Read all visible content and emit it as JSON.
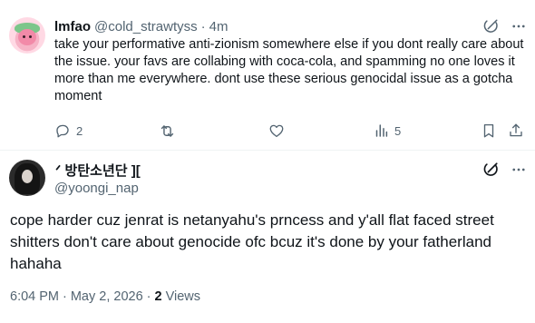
{
  "reply": {
    "display_name": "lmfao",
    "handle": "@cold_strawtyss",
    "separator": "·",
    "time": "4m",
    "text": "take your performative anti-zionism somewhere else if you dont really care about the issue. your favs are collabing with coca-cola,  and spamming no one loves it more than me everywhere. dont use these serious genocidal issue as a gotcha moment",
    "reply_count": "2",
    "retweet_count": "",
    "like_count": "",
    "view_count": "5",
    "icons": [
      "reply-icon",
      "retweet-icon",
      "like-icon",
      "views-icon",
      "bookmark-icon",
      "share-icon",
      "grok-icon",
      "more-icon"
    ]
  },
  "main_tweet": {
    "display_name": "ᐟ 방탄소년단 ][",
    "handle": "@yoongi_nap",
    "text": "cope harder cuz  jenrat is netanyahu's prncess and y'all flat faced street shitters don't care about genocide ofc bcuz it's done by your fatherland hahaha",
    "time": "6:04 PM",
    "separator": "·",
    "date": "May 2, 2026",
    "separator2": "·",
    "views_count": "2",
    "views_label": "Views",
    "icons": [
      "grok-icon",
      "more-icon"
    ]
  },
  "colors": {
    "text_primary": "#0f1419",
    "text_secondary": "#536471",
    "divider": "#eff3f4",
    "background": "#ffffff"
  }
}
